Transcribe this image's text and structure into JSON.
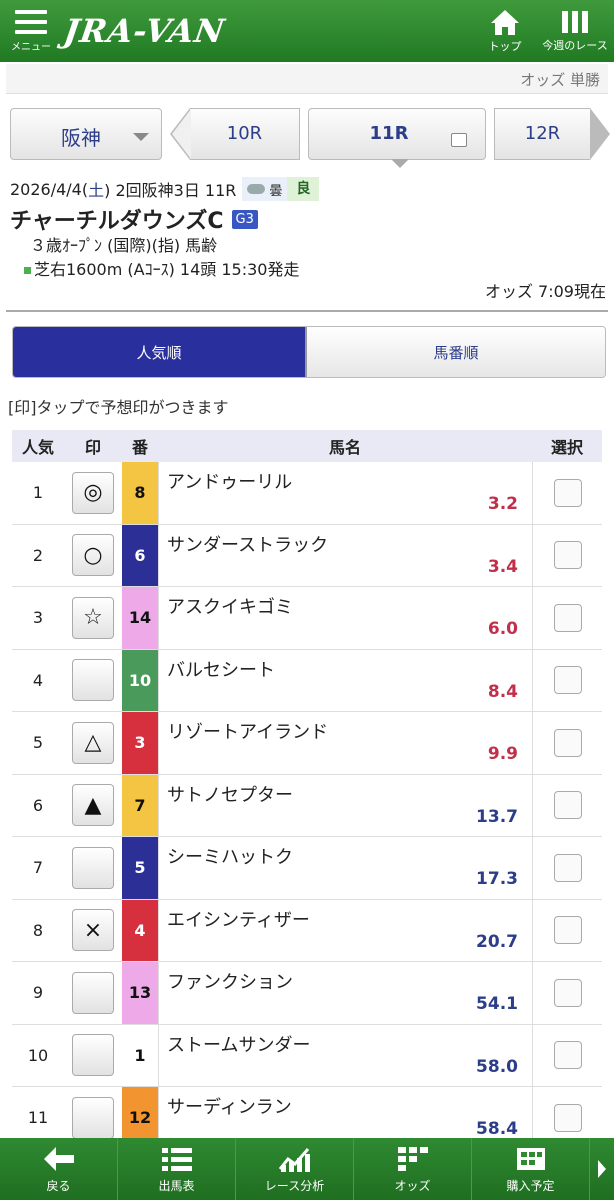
{
  "header": {
    "menu_label": "メニュー",
    "logo": "JRA-VAN",
    "top_label": "トップ",
    "week_label": "今週のレース"
  },
  "subbar": {
    "text": "オッズ 単勝"
  },
  "nav": {
    "venue": "阪神",
    "prev": "10R",
    "current": "11R",
    "next": "12R"
  },
  "race": {
    "date": "2026/4/4(",
    "weekday": "土",
    "date_rest": ") 2回阪神3日 11R",
    "weather": "曇",
    "track_cond": "良",
    "name": "チャーチルダウンズC",
    "grade": "G3",
    "conditions": "３歳ｵｰﾌﾟﾝ (国際)(指) 馬齢",
    "course": "芝右1600m (Aｺｰｽ) 14頭 15:30発走",
    "odds_time": "オッズ 7:09現在"
  },
  "tabs": {
    "popular": "人気順",
    "number": "馬番順"
  },
  "note": "[印]タップで予想印がつきます",
  "table": {
    "headers": {
      "rank": "人気",
      "mark": "印",
      "num": "番",
      "name": "馬名",
      "select": "選択"
    },
    "rows": [
      {
        "rank": "1",
        "mark": "◎",
        "num": "8",
        "name": "アンドゥーリル",
        "odds": "3.2"
      },
      {
        "rank": "2",
        "mark": "○",
        "num": "6",
        "name": "サンダーストラック",
        "odds": "3.4"
      },
      {
        "rank": "3",
        "mark": "☆",
        "num": "14",
        "name": "アスクイキゴミ",
        "odds": "6.0"
      },
      {
        "rank": "4",
        "mark": "",
        "num": "10",
        "name": "バルセシート",
        "odds": "8.4"
      },
      {
        "rank": "5",
        "mark": "△",
        "num": "3",
        "name": "リゾートアイランド",
        "odds": "9.9"
      },
      {
        "rank": "6",
        "mark": "▲",
        "num": "7",
        "name": "サトノセプター",
        "odds": "13.7"
      },
      {
        "rank": "7",
        "mark": "",
        "num": "5",
        "name": "シーミハットク",
        "odds": "17.3"
      },
      {
        "rank": "8",
        "mark": "×",
        "num": "4",
        "name": "エイシンティザー",
        "odds": "20.7"
      },
      {
        "rank": "9",
        "mark": "",
        "num": "13",
        "name": "ファンクション",
        "odds": "54.1"
      },
      {
        "rank": "10",
        "mark": "",
        "num": "1",
        "name": "ストームサンダー",
        "odds": "58.0"
      },
      {
        "rank": "11",
        "mark": "",
        "num": "12",
        "name": "サーディンラン",
        "odds": "58.4"
      }
    ]
  },
  "colors": {
    "frame": {
      "1": "#ffffff",
      "3": "#d6303f",
      "4": "#d6303f",
      "5": "#2b2f96",
      "6": "#2b2f96",
      "7": "#f4c542",
      "8": "#f4c542",
      "10": "#4a9a5b",
      "12": "#f29430",
      "13": "#eeaae8",
      "14": "#eeaae8"
    },
    "odds_red": "#c0304a",
    "odds_blue": "#2c3d8a"
  },
  "footer": {
    "back": "戻る",
    "entries": "出馬表",
    "analysis": "レース分析",
    "odds": "オッズ",
    "purchase": "購入予定"
  }
}
